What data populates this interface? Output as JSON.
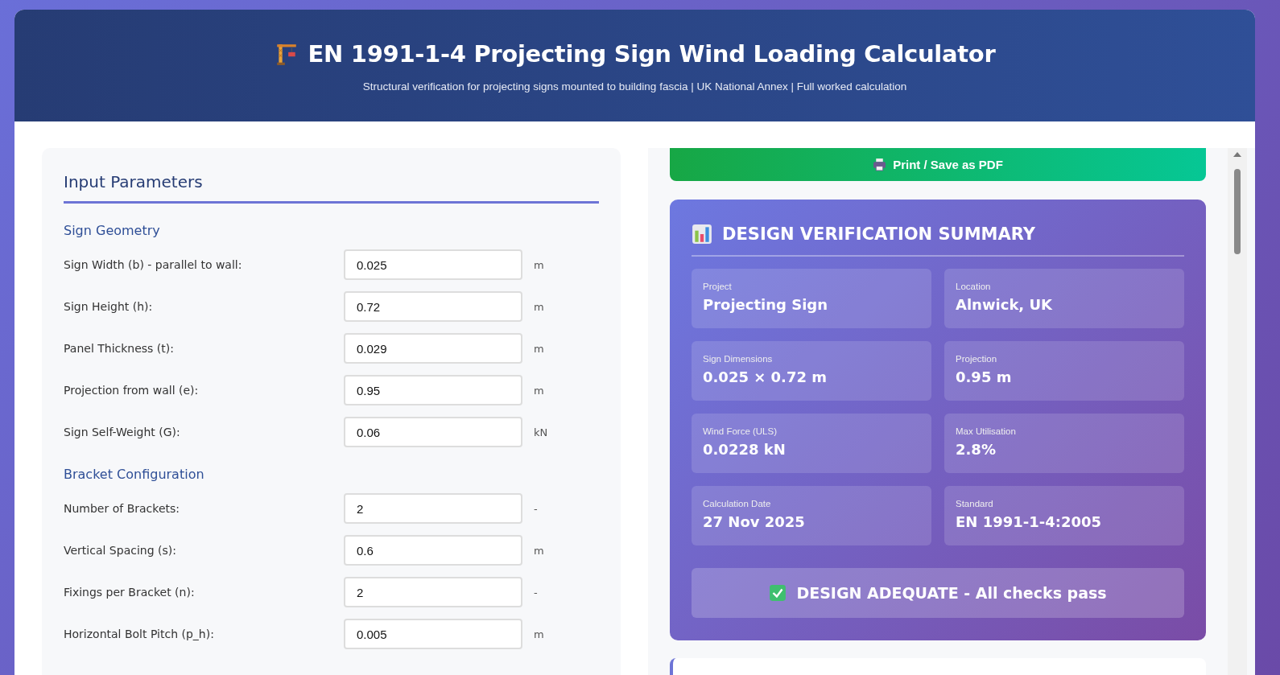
{
  "header": {
    "title": "EN 1991-1-4 Projecting Sign Wind Loading Calculator",
    "subtitle": "Structural verification for projecting signs mounted to building fascia | UK National Annex | Full worked calculation"
  },
  "input_panel": {
    "title": "Input Parameters",
    "sections": [
      {
        "title": "Sign Geometry",
        "fields": [
          {
            "label": "Sign Width (b) - parallel to wall:",
            "value": "0.025",
            "unit": "m"
          },
          {
            "label": "Sign Height (h):",
            "value": "0.72",
            "unit": "m"
          },
          {
            "label": "Panel Thickness (t):",
            "value": "0.029",
            "unit": "m"
          },
          {
            "label": "Projection from wall (e):",
            "value": "0.95",
            "unit": "m"
          },
          {
            "label": "Sign Self-Weight (G):",
            "value": "0.06",
            "unit": "kN"
          }
        ]
      },
      {
        "title": "Bracket Configuration",
        "fields": [
          {
            "label": "Number of Brackets:",
            "value": "2",
            "unit": "-"
          },
          {
            "label": "Vertical Spacing (s):",
            "value": "0.6",
            "unit": "m"
          },
          {
            "label": "Fixings per Bracket (n):",
            "value": "2",
            "unit": "-"
          },
          {
            "label": "Horizontal Bolt Pitch (p_h):",
            "value": "0.005",
            "unit": "m"
          }
        ]
      }
    ]
  },
  "print_button": {
    "label": "Print / Save as PDF"
  },
  "summary": {
    "title": "DESIGN VERIFICATION SUMMARY",
    "items": [
      {
        "label": "Project",
        "value": "Projecting Sign"
      },
      {
        "label": "Location",
        "value": "Alnwick, UK"
      },
      {
        "label": "Sign Dimensions",
        "value": "0.025 × 0.72 m"
      },
      {
        "label": "Projection",
        "value": "0.95 m"
      },
      {
        "label": "Wind Force (ULS)",
        "value": "0.0228 kN"
      },
      {
        "label": "Max Utilisation",
        "value": "2.8%"
      },
      {
        "label": "Calculation Date",
        "value": "27 Nov 2025"
      },
      {
        "label": "Standard",
        "value": "EN 1991-1-4:2005"
      }
    ],
    "status": "DESIGN ADEQUATE - All checks pass"
  }
}
